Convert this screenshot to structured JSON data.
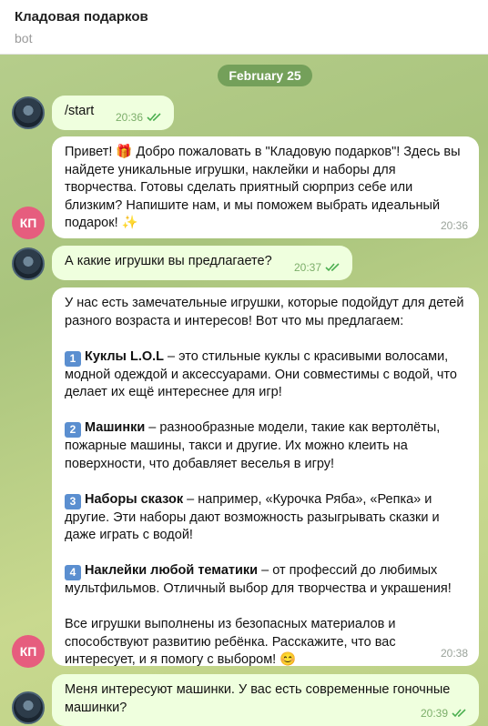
{
  "header": {
    "title": "Кладовая подарков",
    "subtitle": "bot"
  },
  "date_chip": "February 25",
  "avatars": {
    "bot_initials": "КП"
  },
  "messages": {
    "m1": {
      "text": "/start",
      "time": "20:36"
    },
    "m2": {
      "lines": [
        "Привет! 🎁 Добро пожаловать в \"Кладовую подарков\"! Здесь вы",
        "найдете уникальные игрушки, наклейки и наборы для",
        "творчества. Готовы сделать приятный сюрприз себе или",
        "близким? Напишите нам, и мы поможем выбрать идеальный",
        "подарок! ✨"
      ],
      "time": "20:36"
    },
    "m3": {
      "text": "А какие игрушки вы предлагаете?",
      "time": "20:37"
    },
    "m4": {
      "intro": [
        "У нас есть замечательные игрушки, которые подойдут для детей",
        "разного возраста и интересов! Вот что мы предлагаем:"
      ],
      "items": [
        {
          "num": "1",
          "title": "Куклы L.O.L",
          "lines": [
            " – это стильные куклы с красивыми волосами,",
            "модной одеждой и аксессуарами. Они совместимы с водой, что",
            "делает их ещё интереснее для игр!"
          ]
        },
        {
          "num": "2",
          "title": "Машинки",
          "lines": [
            " – разнообразные модели, такие как вертолёты,",
            "пожарные машины, такси и другие. Их можно клеить на",
            "поверхности, что добавляет веселья в игру!"
          ]
        },
        {
          "num": "3",
          "title": "Наборы сказок",
          "lines": [
            " – например, «Курочка Ряба», «Репка» и",
            "другие. Эти наборы дают возможность разыгрывать сказки и",
            "даже играть с водой!"
          ]
        },
        {
          "num": "4",
          "title": "Наклейки любой тематики",
          "lines": [
            " – от профессий до любимых",
            "мультфильмов. Отличный выбор для творчества и украшения!"
          ]
        }
      ],
      "outro": [
        "Все игрушки выполнены из безопасных материалов и",
        "способствуют развитию ребёнка. Расскажите, что вас",
        "интересует, и я помогу с выбором! 😊"
      ],
      "time": "20:38"
    },
    "m5": {
      "lines": [
        "Меня интересуют машинки. У вас есть современные гоночные",
        "машинки?"
      ],
      "time": "20:39"
    }
  }
}
